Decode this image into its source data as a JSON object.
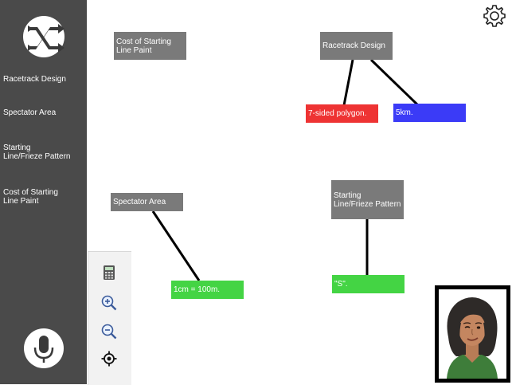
{
  "sidebar": {
    "items": [
      {
        "label": "Racetrack Design"
      },
      {
        "label": "Spectator Area"
      },
      {
        "label": "Starting\nLine/Frieze Pattern"
      },
      {
        "label": "Cost of Starting\nLine Paint"
      }
    ]
  },
  "icons": {
    "logo": "shuffle-arrows-icon",
    "mic": "microphone-icon",
    "settings": "gear-icon",
    "calculator": "calculator-icon",
    "zoom_in": "zoom-in-icon",
    "zoom_out": "zoom-out-icon",
    "locate": "crosshair-icon"
  },
  "canvas": {
    "nodes": {
      "cost": "Cost of Starting\nLine Paint",
      "racetrack": "Racetrack Design",
      "polygon": "7-sided polygon.",
      "distance": "5km.",
      "spectator": "Spectator Area",
      "scale": "1cm = 100m.",
      "frieze": "Starting\nLine/Frieze Pattern",
      "pattern": "\"S\"."
    }
  },
  "colors": {
    "sidebar": "#4a4a4a",
    "topic": "#7a7a7a",
    "red": "#ee3333",
    "blue": "#3b3bf7",
    "green": "#44d444"
  }
}
